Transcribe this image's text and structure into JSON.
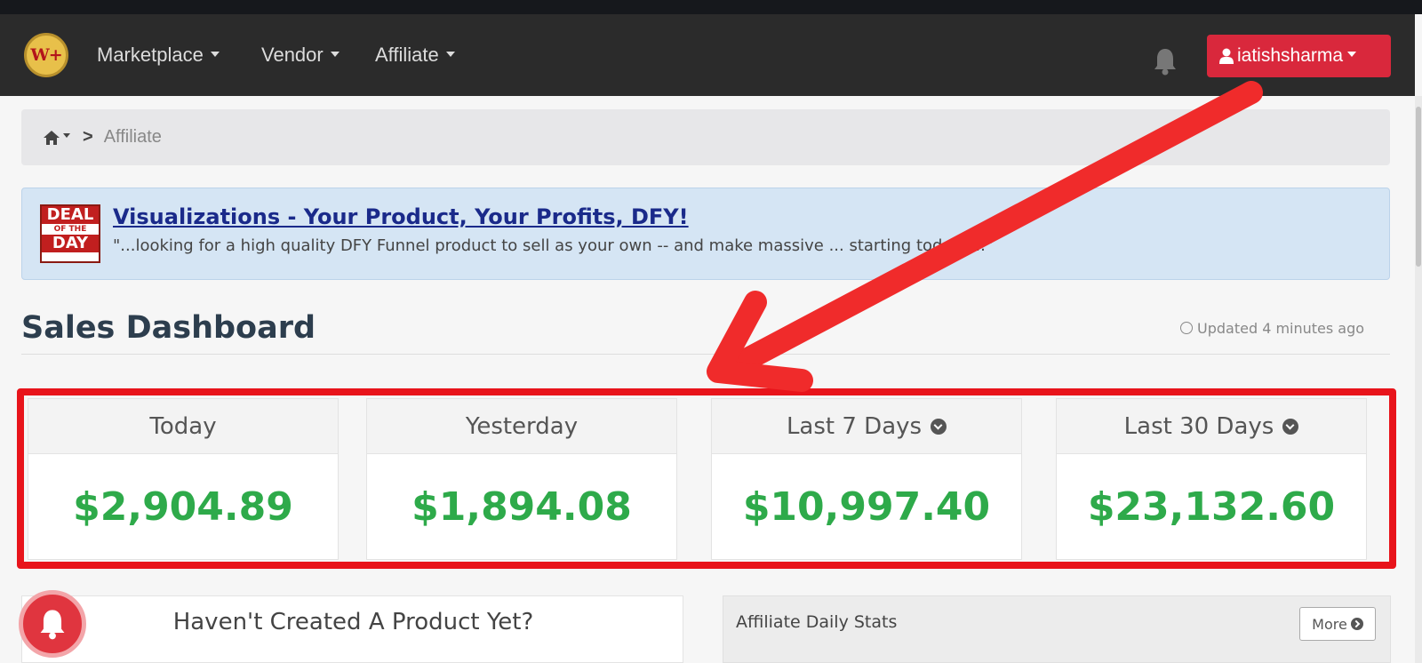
{
  "navbar": {
    "logo_text": "W+",
    "menu": [
      {
        "label": "Marketplace"
      },
      {
        "label": "Vendor"
      },
      {
        "label": "Affiliate"
      }
    ],
    "user": {
      "name": "iatishsharma"
    }
  },
  "breadcrumb": {
    "current": "Affiliate",
    "separator": ">"
  },
  "deal": {
    "badge": {
      "line1": "DEAL",
      "line2": "OF THE",
      "line3": "DAY"
    },
    "title": "Visualizations - Your Product, Your Profits, DFY!",
    "description": "\"...looking for a high quality DFY Funnel product to sell as your own -- and make massive ... starting today?...\""
  },
  "dashboard": {
    "title": "Sales Dashboard",
    "updated": "Updated 4 minutes ago",
    "stats": [
      {
        "label": "Today",
        "value": "$2,904.89",
        "has_dropdown": false
      },
      {
        "label": "Yesterday",
        "value": "$1,894.08",
        "has_dropdown": false
      },
      {
        "label": "Last 7 Days",
        "value": "$10,997.40",
        "has_dropdown": true
      },
      {
        "label": "Last 30 Days",
        "value": "$23,132.60",
        "has_dropdown": true
      }
    ]
  },
  "panels": {
    "left_title": "Haven't Created A Product Yet?",
    "right_title": "Affiliate Daily Stats",
    "more_label": "More"
  },
  "colors": {
    "navbar": "#2b2b2b",
    "user_button": "#d9283c",
    "stat_value": "#2eaa4a",
    "highlight_frame": "#e8141b",
    "deal_background": "#d5e5f4"
  },
  "icons": [
    "bell-icon",
    "user-icon",
    "home-icon",
    "clock-icon",
    "chevron-circle-down-icon",
    "chevron-circle-right-icon",
    "notification-bell-icon"
  ]
}
